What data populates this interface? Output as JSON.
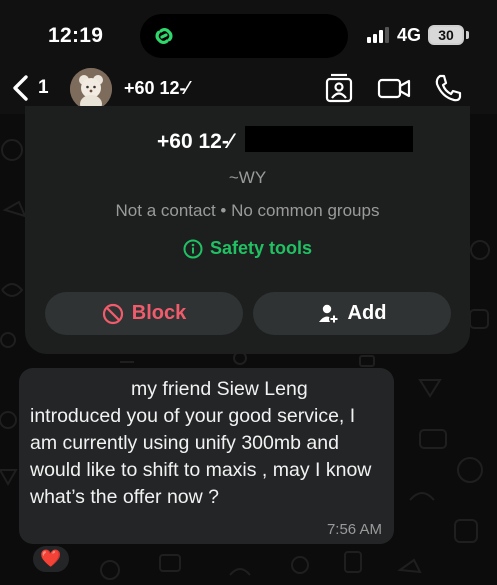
{
  "status_bar": {
    "time": "12:19",
    "network": "4G",
    "battery": "30"
  },
  "header": {
    "back_count": "1",
    "title": "+60 12-⁄"
  },
  "contact_card": {
    "number": "+60 12-⁄",
    "nickname": "~WY",
    "meta": "Not a contact • No common groups",
    "safety_label": "Safety tools",
    "block_label": "Block",
    "add_label": "Add"
  },
  "message": {
    "text": "my friend Siew Leng introduced you of your good service, I am currently using unify 300mb and would like to shift to maxis , may I know what’s the offer now ?",
    "time": "7:56 AM",
    "reaction": "❤️"
  },
  "colors": {
    "accent_green": "#21c063",
    "block_red": "#f15c6d",
    "bubble": "#232526",
    "card": "#1d1f1f"
  },
  "icons": [
    "chevron-left-icon",
    "link-icon",
    "signal-icon",
    "contact-card-icon",
    "video-call-icon",
    "phone-icon",
    "info-icon",
    "block-icon",
    "add-person-icon",
    "heart-reaction"
  ]
}
